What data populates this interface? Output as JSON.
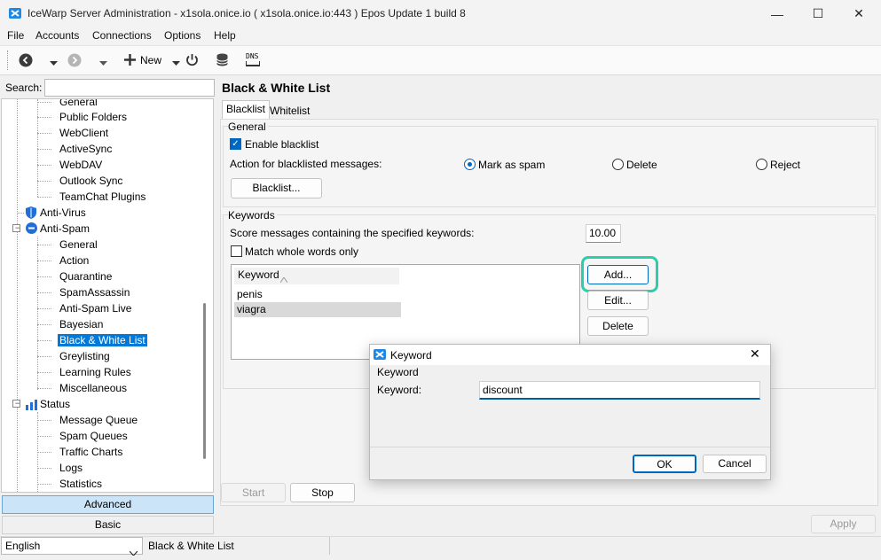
{
  "window": {
    "title": "IceWarp Server Administration - x1sola.onice.io ( x1sola.onice.io:443 ) Epos Update 1 build 8",
    "minimize": "—",
    "maximize": "☐",
    "close": "✕"
  },
  "menu": [
    "File",
    "Accounts",
    "Connections",
    "Options",
    "Help"
  ],
  "toolbar": {
    "new_label": "New",
    "dns_label": "DNS"
  },
  "search": {
    "label": "Search:",
    "value": ""
  },
  "tree": {
    "items": [
      "General",
      "Public Folders",
      "WebClient",
      "ActiveSync",
      "WebDAV",
      "Outlook Sync",
      "TeamChat Plugins",
      "Anti-Virus",
      "Anti-Spam",
      "General",
      "Action",
      "Quarantine",
      "SpamAssassin",
      "Anti-Spam Live",
      "Bayesian",
      "Black & White List",
      "Greylisting",
      "Learning Rules",
      "Miscellaneous",
      "Status",
      "Message Queue",
      "Spam Queues",
      "Traffic Charts",
      "Logs",
      "Statistics"
    ],
    "selected": "Black & White List"
  },
  "mode_buttons": {
    "advanced": "Advanced",
    "basic": "Basic"
  },
  "page": {
    "title": "Black & White List",
    "tabs": [
      "Blacklist",
      "Whitelist"
    ],
    "general": {
      "legend": "General",
      "enable_label": "Enable blacklist",
      "enable_checked": true,
      "action_label": "Action for blacklisted messages:",
      "options": [
        "Mark as spam",
        "Delete",
        "Reject"
      ],
      "selected_option": "Mark as spam",
      "blacklist_button": "Blacklist..."
    },
    "keywords": {
      "legend": "Keywords",
      "score_label": "Score messages containing the specified keywords:",
      "score_value": "10.00",
      "match_label": "Match whole words only",
      "match_checked": false,
      "column_header": "Keyword",
      "rows": [
        "penis",
        "viagra"
      ],
      "selected_row": "viagra",
      "add_button": "Add...",
      "edit_button": "Edit...",
      "delete_button": "Delete"
    },
    "start_button": "Start",
    "stop_button": "Stop",
    "apply_button": "Apply"
  },
  "status_bar": {
    "language": "English",
    "current_page": "Black & White List"
  },
  "dialog": {
    "title": "Keyword",
    "group_label": "Keyword",
    "field_label": "Keyword:",
    "field_value": "discount",
    "ok": "OK",
    "cancel": "Cancel",
    "close": "✕"
  },
  "colors": {
    "accent": "#0078d7",
    "highlight_ring": "#2ecdaa",
    "selection_bg": "#0078d7"
  }
}
